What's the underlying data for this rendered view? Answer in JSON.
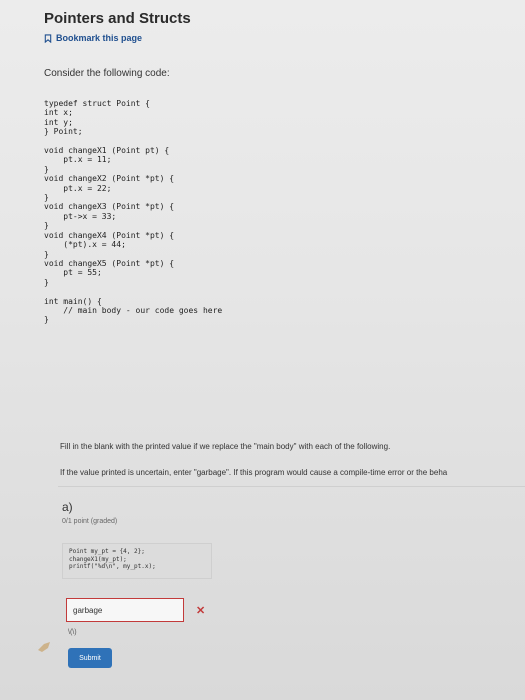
{
  "header": {
    "title": "Pointers and Structs",
    "bookmark_label": "Bookmark this page"
  },
  "question": {
    "intro": "Consider the following code:",
    "code": "typedef struct Point {\nint x;\nint y;\n} Point;\n\nvoid changeX1 (Point pt) {\n    pt.x = 11;\n}\nvoid changeX2 (Point *pt) {\n    pt.x = 22;\n}\nvoid changeX3 (Point *pt) {\n    pt->x = 33;\n}\nvoid changeX4 (Point *pt) {\n    (*pt).x = 44;\n}\nvoid changeX5 (Point *pt) {\n    pt = 55;\n}\n\nint main() {\n    // main body - our code goes here\n}",
    "instruction_1": "Fill in the blank with the printed value if we replace the \"main body\" with each of the following.",
    "instruction_2": "If the value printed is uncertain, enter \"garbage\". If this program would cause a compile-time error or the beha"
  },
  "part_a": {
    "label": "a)",
    "points": "0/1 point (graded)",
    "code": "Point my_pt = {4, 2};\nchangeX1(my_pt);\nprintf(\"%d\\n\", my_pt.x);",
    "answer": "garbage",
    "result_icon": "x-mark-icon",
    "small_text": "\\(\\)",
    "submit_label": "Submit"
  },
  "colors": {
    "accent": "#2f72b8",
    "error": "#c23a3a",
    "link": "#1f4f8f"
  }
}
